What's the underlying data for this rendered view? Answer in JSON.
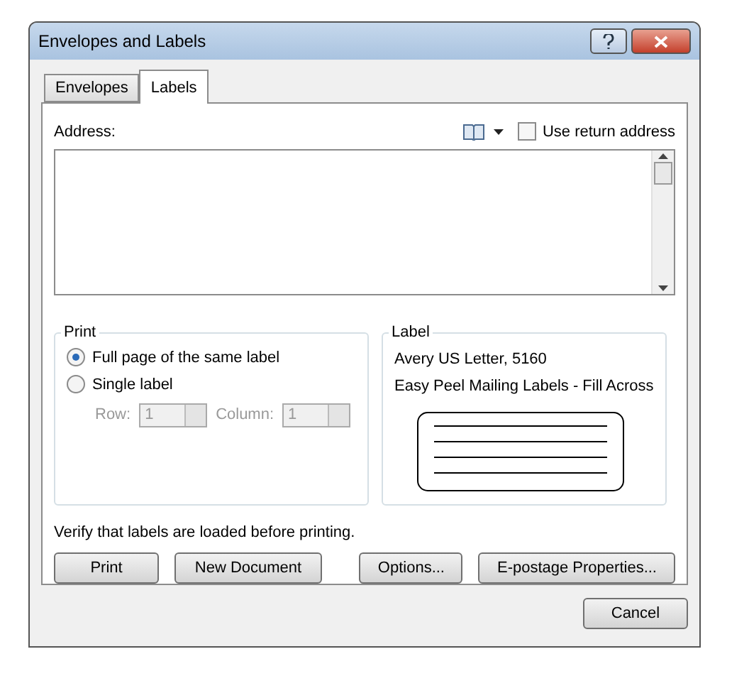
{
  "window": {
    "title": "Envelopes and Labels"
  },
  "tabs": [
    {
      "label": "Envelopes",
      "selected": false
    },
    {
      "label": "Labels",
      "selected": true
    }
  ],
  "address": {
    "label": "Address:"
  },
  "use_return_address": {
    "label": "Use return address",
    "checked": false
  },
  "print": {
    "title": "Print",
    "options": [
      {
        "label": "Full page of the same label",
        "selected": true
      },
      {
        "label": "Single label",
        "selected": false
      }
    ],
    "row": {
      "label": "Row:",
      "value": "1",
      "disabled": true
    },
    "column": {
      "label": "Column:",
      "value": "1",
      "disabled": true
    }
  },
  "label": {
    "title": "Label",
    "lines": [
      "Avery US Letter, 5160",
      "Easy Peel Mailing Labels - Fill Across"
    ]
  },
  "note": "Verify that labels are loaded before printing.",
  "left_buttons": [
    "Print",
    "New Document"
  ],
  "right_buttons": [
    "Options...",
    "E-postage Properties..."
  ],
  "cancel": "Cancel"
}
